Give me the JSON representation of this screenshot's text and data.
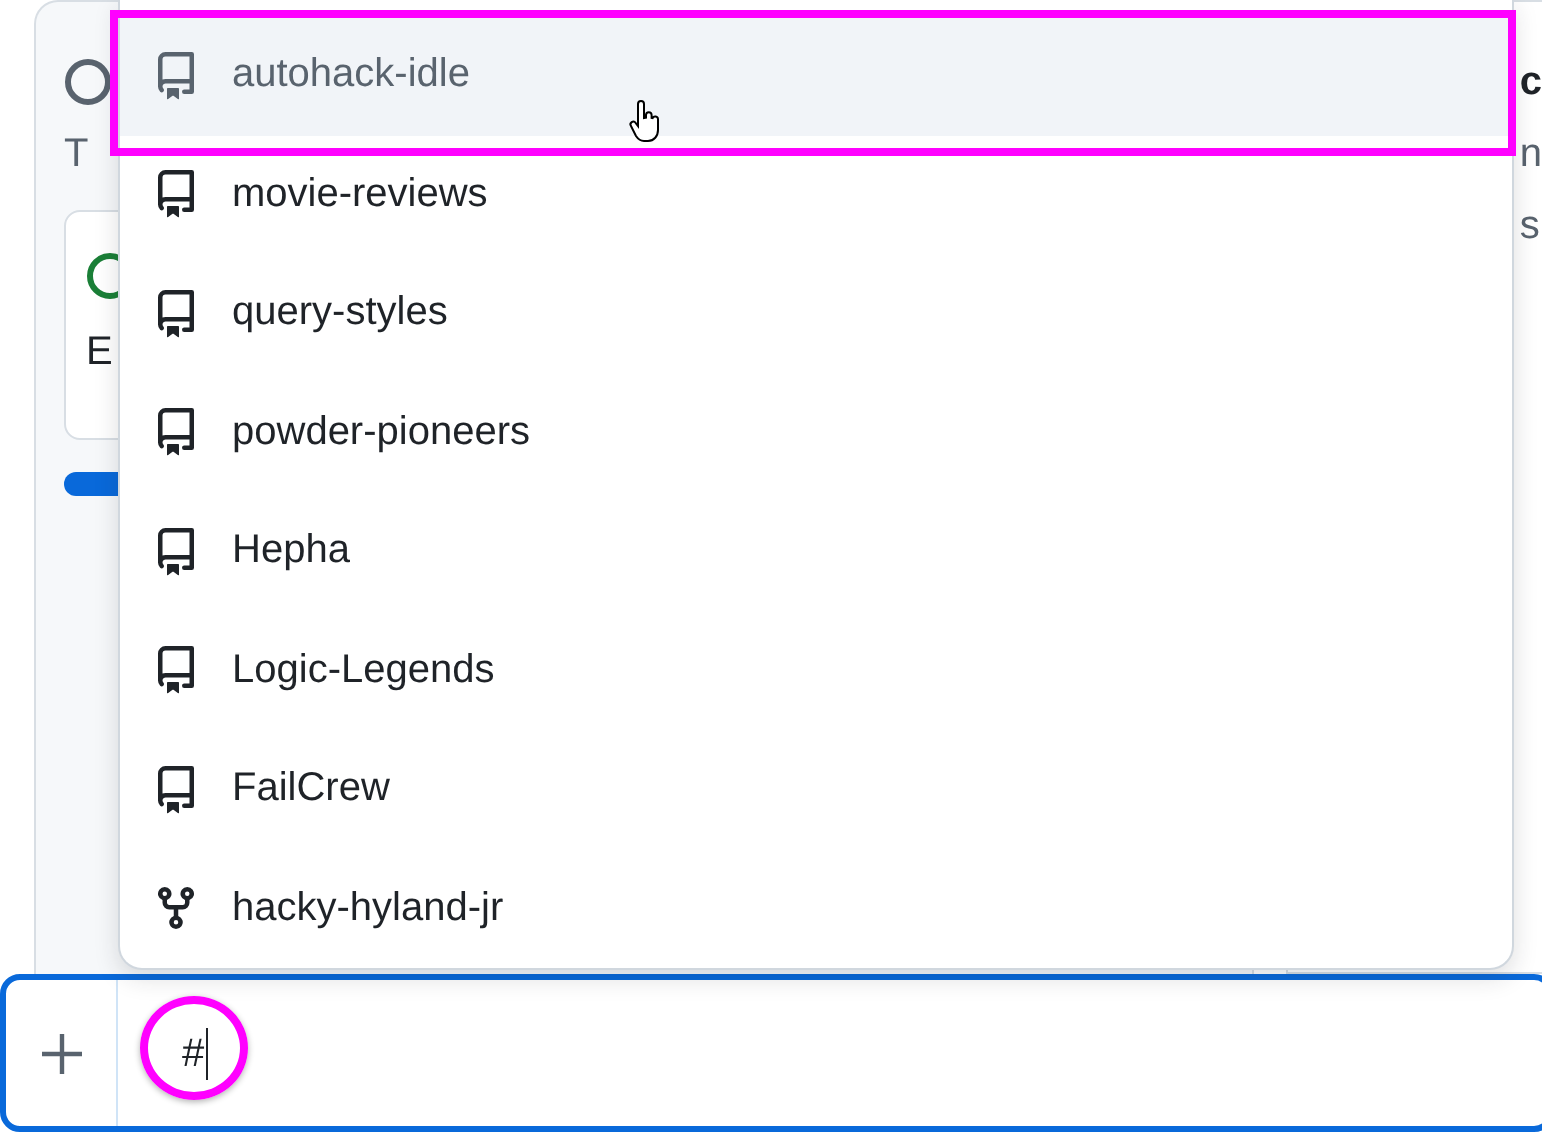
{
  "background": {
    "left_panel": {
      "fragments": [
        "T",
        "E"
      ]
    },
    "right_panel": {
      "fragments": [
        "c",
        "n",
        "s"
      ]
    }
  },
  "suggestions": [
    {
      "kind": "repo",
      "label": "autohack-idle",
      "selected": true
    },
    {
      "kind": "repo",
      "label": "movie-reviews",
      "selected": false
    },
    {
      "kind": "repo",
      "label": "query-styles",
      "selected": false
    },
    {
      "kind": "repo",
      "label": "powder-pioneers",
      "selected": false
    },
    {
      "kind": "repo",
      "label": "Hepha",
      "selected": false
    },
    {
      "kind": "repo",
      "label": "Logic-Legends",
      "selected": false
    },
    {
      "kind": "repo",
      "label": "FailCrew",
      "selected": false
    },
    {
      "kind": "fork",
      "label": "hacky-hyland-jr",
      "selected": false
    }
  ],
  "composer": {
    "value": "#"
  }
}
